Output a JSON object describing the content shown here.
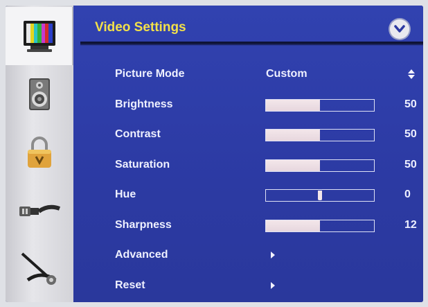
{
  "header": {
    "title": "Video Settings",
    "menu_icon": "chevron-down-icon"
  },
  "sidebar": {
    "items": [
      {
        "name": "video",
        "icon": "tv-icon",
        "active": true
      },
      {
        "name": "audio",
        "icon": "speaker-icon",
        "active": false
      },
      {
        "name": "parental",
        "icon": "lock-icon",
        "active": false
      },
      {
        "name": "connections",
        "icon": "cable-icon",
        "active": false
      },
      {
        "name": "setup",
        "icon": "tools-icon",
        "active": false
      }
    ]
  },
  "settings": {
    "picture_mode": {
      "label": "Picture Mode",
      "value": "Custom"
    },
    "brightness": {
      "label": "Brightness",
      "value": "50",
      "level": 0.5
    },
    "contrast": {
      "label": "Contrast",
      "value": "50",
      "level": 0.5
    },
    "saturation": {
      "label": "Saturation",
      "value": "50",
      "level": 0.5
    },
    "hue": {
      "label": "Hue",
      "value": "0",
      "level": 0.5
    },
    "sharpness": {
      "label": "Sharpness",
      "value": "12",
      "level": 0.5
    },
    "advanced": {
      "label": "Advanced"
    },
    "reset": {
      "label": "Reset"
    }
  },
  "colors": {
    "title": "#f2e04a",
    "panel": "#2b3a9e",
    "text": "#eef0ff",
    "slider_fill": "#efe2e7"
  }
}
